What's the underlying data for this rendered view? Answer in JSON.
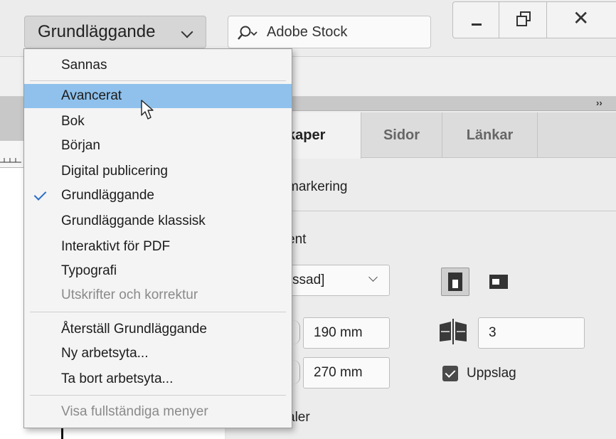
{
  "topbar": {
    "workspace_label": "Grundläggande",
    "search_placeholder": "Adobe Stock"
  },
  "workspace_menu": {
    "items_group1": [
      "Sannas"
    ],
    "items_group2": [
      "Avancerat",
      "Bok",
      "Början",
      "Digital publicering",
      "Grundläggande",
      "Grundläggande klassisk",
      "Interaktivt för PDF",
      "Typografi",
      "Utskrifter och korrektur"
    ],
    "highlighted": "Avancerat",
    "checked": "Grundläggande",
    "disabled": [
      "Utskrifter och korrektur",
      "Visa fullständiga menyer"
    ],
    "items_group3": [
      "Återställ Grundläggande",
      "Ny arbetsyta...",
      "Ta bort arbetsyta..."
    ],
    "items_group4": [
      "Visa fullständiga menyer"
    ]
  },
  "panel": {
    "collapse_label": "››",
    "tabs": [
      "kaper",
      "Sidor",
      "Länkar"
    ],
    "no_selection": "markering",
    "document_section": "ent",
    "preset_value": "ssad]",
    "width_value": "190 mm",
    "height_value": "270 mm",
    "pages_value": "3",
    "facing_pages_label": "Uppslag",
    "facing_pages_checked": true,
    "margins_section": "aler"
  },
  "colors": {
    "menu_highlight": "#8fc1ec",
    "check_accent": "#2a6fc9"
  }
}
